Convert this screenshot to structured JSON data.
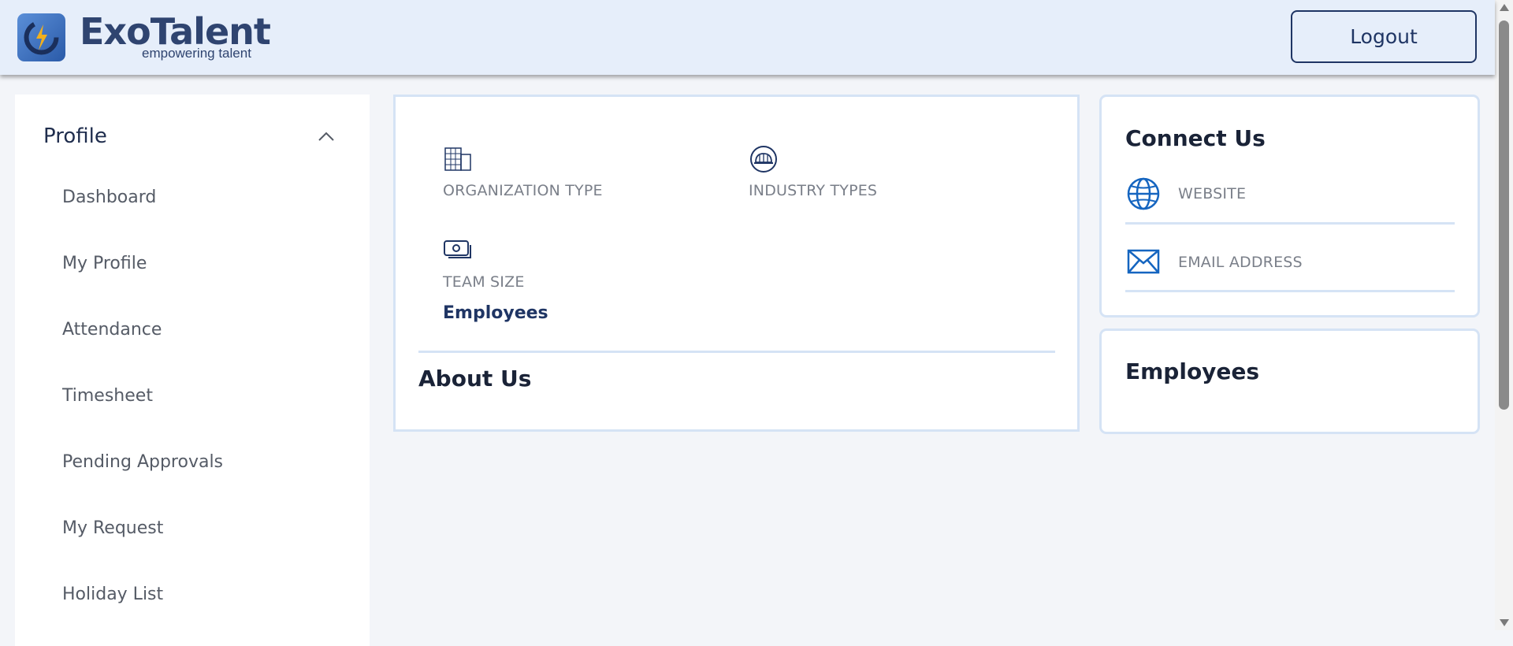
{
  "brand": {
    "name": "ExoTalent",
    "tagline": "empowering talent"
  },
  "header": {
    "logout_label": "Logout"
  },
  "sidebar": {
    "section_title": "Profile",
    "items": [
      {
        "label": "Dashboard"
      },
      {
        "label": "My Profile"
      },
      {
        "label": "Attendance"
      },
      {
        "label": "Timesheet"
      },
      {
        "label": "Pending Approvals"
      },
      {
        "label": "My Request"
      },
      {
        "label": "Holiday List"
      }
    ]
  },
  "company": {
    "organization_type_label": "ORGANIZATION TYPE",
    "industry_types_label": "INDUSTRY TYPES",
    "team_size_label": "TEAM SIZE",
    "team_size_value": "Employees",
    "about_title": "About Us"
  },
  "connect": {
    "title": "Connect Us",
    "website_label": "WEBSITE",
    "email_label": "EMAIL ADDRESS"
  },
  "employees_card": {
    "title": "Employees"
  },
  "icons": {
    "logo": "exotalent-logo-icon",
    "chevron": "chevron-up-icon",
    "org": "building-icon",
    "industry": "hard-hat-icon",
    "team": "cash-icon",
    "website": "globe-icon",
    "email": "envelope-icon"
  },
  "colors": {
    "header_bg": "#e6eefa",
    "accent": "#1f3564",
    "icon_blue": "#1565c0",
    "card_border": "#d5e3f5"
  }
}
